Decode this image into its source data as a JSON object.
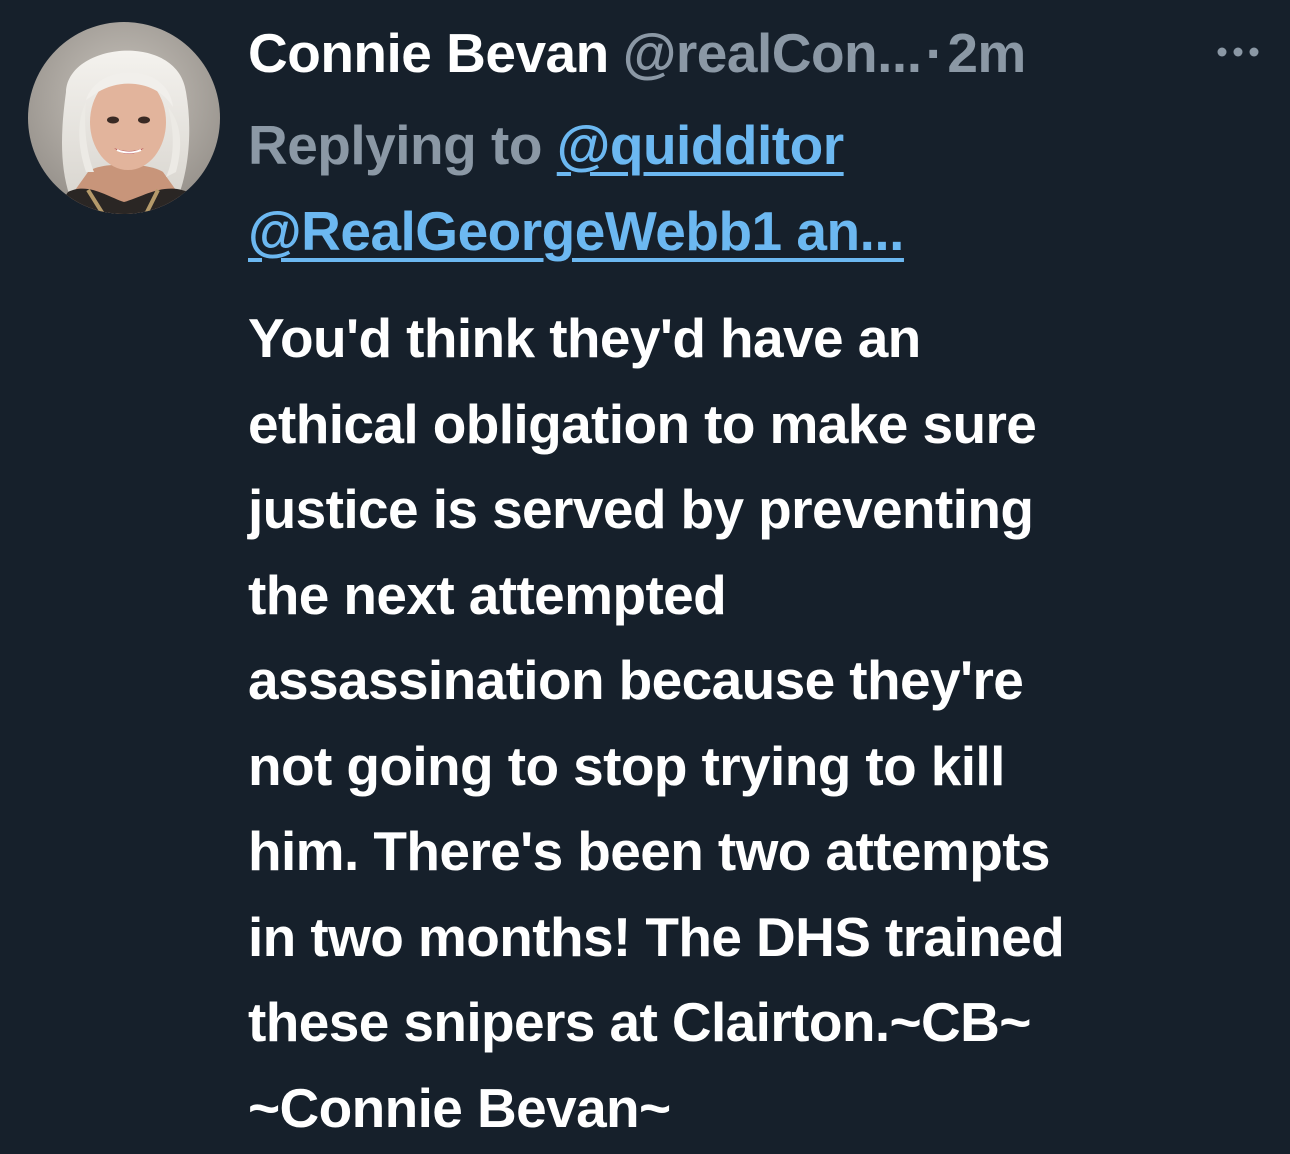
{
  "tweet": {
    "author": {
      "display_name": "Connie Bevan",
      "handle": "@realCon...",
      "avatar_icon": "profile-photo"
    },
    "separator": "·",
    "timestamp": "2m",
    "more_icon": "more-horizontal-icon",
    "replying_to": {
      "prefix": "Replying to ",
      "mention_1": "@quidditor",
      "mention_2": "@RealGeorgeWebb1 an..."
    },
    "body_lines": [
      "You'd think they'd have an",
      "ethical obligation to make sure",
      "justice is served by preventing",
      "the next attempted",
      "assassination because they're",
      "not going to stop trying to kill",
      "him. There's been two attempts",
      "in two months! The DHS trained",
      "these snipers at Clairton.~CB~",
      "~Connie Bevan~"
    ]
  },
  "colors": {
    "background": "#16202b",
    "primary_text": "#ffffff",
    "secondary_text": "#8b98a5",
    "link": "#6cb8f1"
  }
}
